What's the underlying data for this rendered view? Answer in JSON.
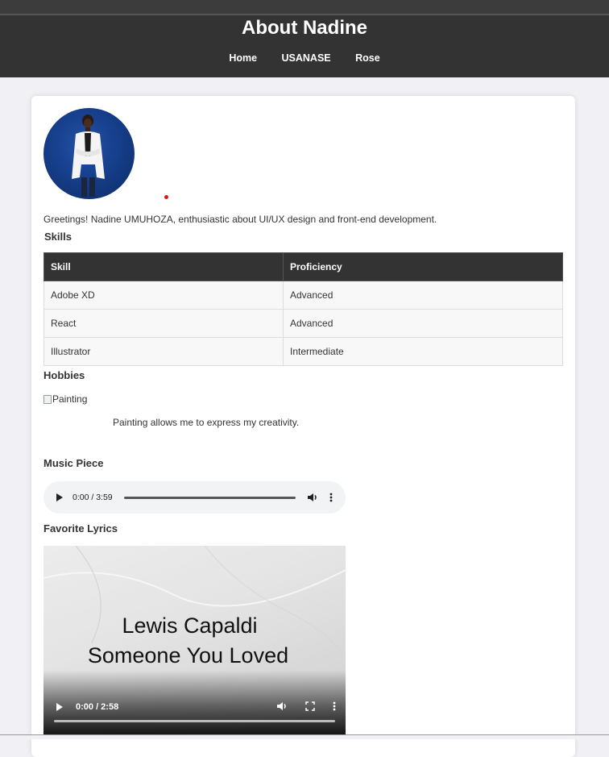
{
  "header": {
    "title": "About Nadine",
    "nav": [
      "Home",
      "USANASE",
      "Rose"
    ]
  },
  "profile": {
    "avatar_alt": "Nadine portrait",
    "intro": "Greetings! Nadine UMUHOZA, enthusiastic about UI/UX design and front-end development."
  },
  "skills": {
    "heading": "Skills",
    "columns": [
      "Skill",
      "Proficiency"
    ],
    "rows": [
      [
        "Adobe XD",
        "Advanced"
      ],
      [
        "React",
        "Advanced"
      ],
      [
        "Illustrator",
        "Intermediate"
      ]
    ]
  },
  "hobbies": {
    "heading": "Hobbies",
    "image_alt": "Painting",
    "caption": "Painting allows me to express my creativity."
  },
  "music": {
    "heading": "Music Piece",
    "audio_time": "0:00 / 3:59"
  },
  "lyrics": {
    "heading": "Favorite Lyrics",
    "video_line1": "Lewis Capaldi",
    "video_line2": "Someone You Loved",
    "video_time": "0:00 / 2:58"
  },
  "colors": {
    "header_bg": "#333333",
    "page_bg": "#f0f0f5",
    "accent_dot": "#d21a1a"
  }
}
